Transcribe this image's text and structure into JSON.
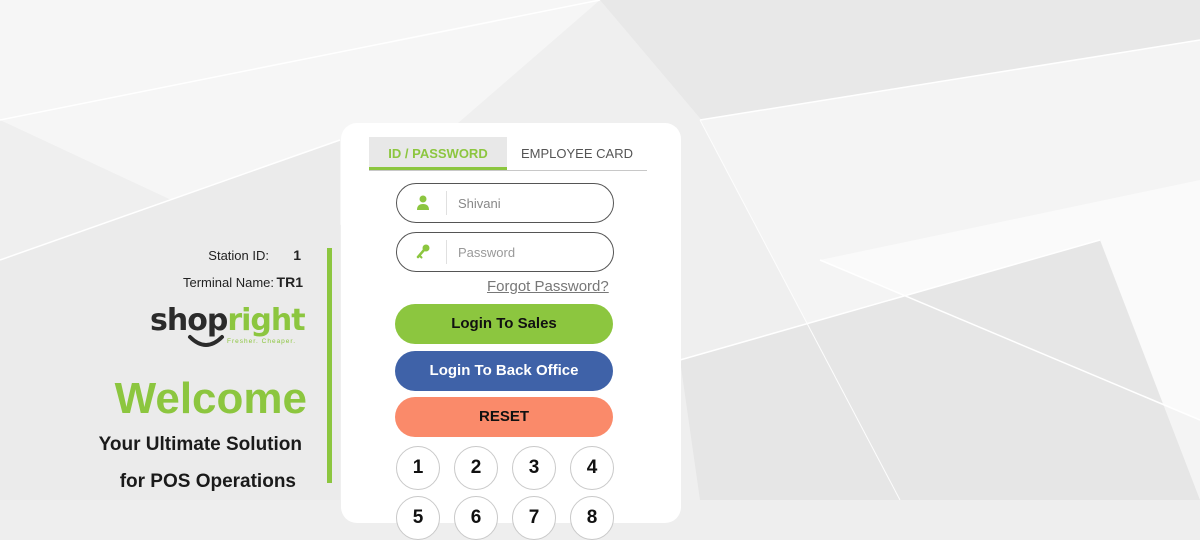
{
  "station": {
    "label": "Station ID:",
    "value": "1"
  },
  "terminal": {
    "label": "Terminal Name:",
    "value": "TR1"
  },
  "logo": {
    "word_a": "shop",
    "word_b": "right",
    "tagline": "Fresher. Cheaper."
  },
  "welcome": {
    "heading": "Welcome",
    "line1": "Your Ultimate Solution",
    "line2": "for POS Operations"
  },
  "tabs": [
    {
      "label": "ID / PASSWORD",
      "active": true
    },
    {
      "label": "EMPLOYEE CARD",
      "active": false
    }
  ],
  "form": {
    "username_value": "Shivani",
    "password_placeholder": "Password",
    "forgot_label": "Forgot Password?"
  },
  "buttons": {
    "sales": "Login To Sales",
    "back_office": "Login To Back Office",
    "reset": "RESET"
  },
  "keypad": [
    "1",
    "2",
    "3",
    "4",
    "5",
    "6",
    "7",
    "8"
  ],
  "colors": {
    "accent": "#8cc63f",
    "back_office": "#3f62a8",
    "reset": "#fa8a6a"
  },
  "icons": {
    "username": "user-icon",
    "password": "key-icon"
  }
}
